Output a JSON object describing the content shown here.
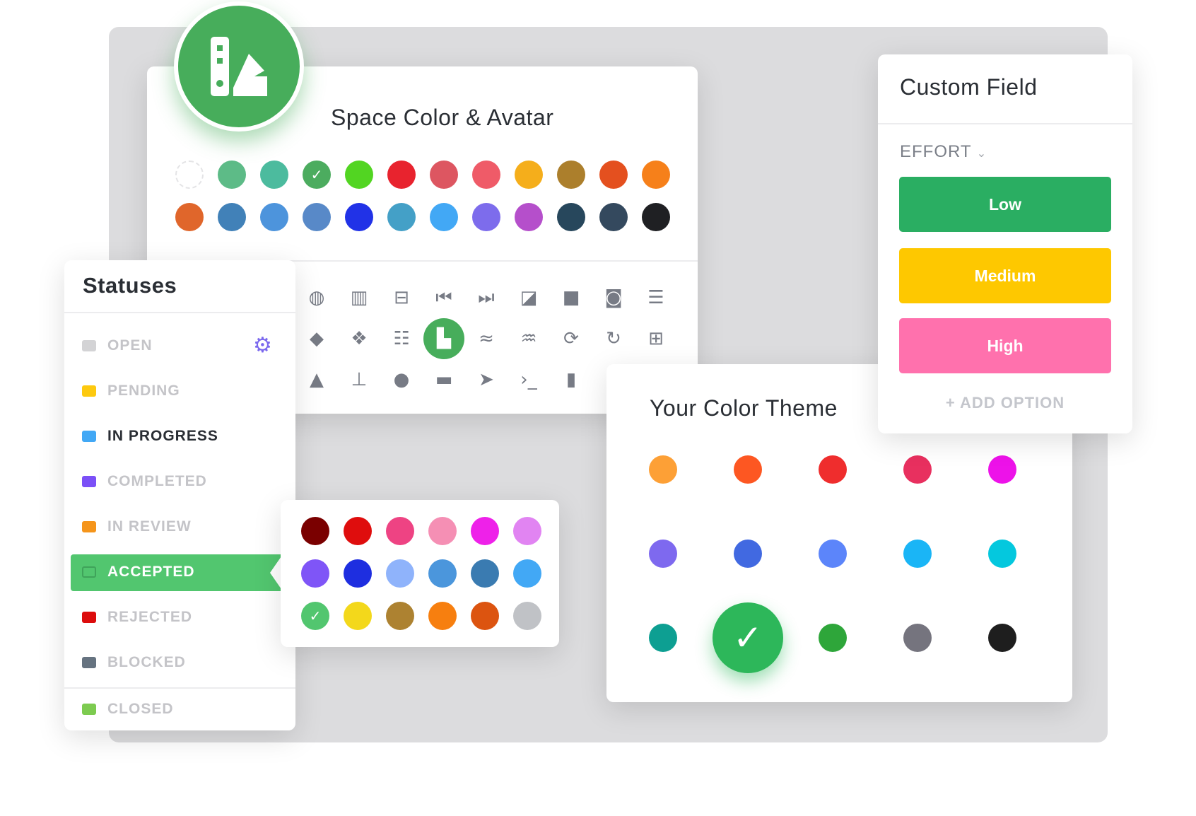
{
  "space": {
    "title": "Space Color & Avatar",
    "colors_row1": [
      "#ffffff",
      "#5dbb87",
      "#4cbb9e",
      "#4cac5f",
      "#52d522",
      "#e8232e",
      "#dd5661",
      "#ef5b68",
      "#f5ae1b",
      "#ac7f2c",
      "#e4501f",
      "#f6801a"
    ],
    "colors_row2": [
      "#e0662b",
      "#4181b8",
      "#4d94dc",
      "#5889c8",
      "#2132e7",
      "#44a0c7",
      "#42a8f5",
      "#7d6cec",
      "#b54fcb",
      "#27475c",
      "#34495e",
      "#1f2023"
    ],
    "selected_color_index": 3,
    "icons": [
      [
        "soccer-ball",
        "◍"
      ],
      [
        "briefcase",
        "▥"
      ],
      [
        "luggage",
        "⊟"
      ],
      [
        "skip-back",
        "⏮"
      ],
      [
        "skip-forward",
        "⏭"
      ],
      [
        "sticky-note",
        "◪"
      ],
      [
        "square",
        "■"
      ],
      [
        "circle-stop",
        "◙"
      ],
      [
        "bars",
        "☰"
      ],
      [
        "tag",
        "◆"
      ],
      [
        "tags",
        "❖"
      ],
      [
        "checklist",
        "☷"
      ],
      [
        "swatch",
        "▙"
      ],
      [
        "swimmer",
        "≈"
      ],
      [
        "pool",
        "♒"
      ],
      [
        "refresh",
        "⟳"
      ],
      [
        "sync",
        "↻"
      ],
      [
        "table",
        "⊞"
      ],
      [
        "thumbs-up",
        "▲"
      ],
      [
        "pushpin",
        "⊥"
      ],
      [
        "drop",
        "●"
      ],
      [
        "car",
        "▬"
      ],
      [
        "paper-plane",
        "➤"
      ],
      [
        "terminal",
        "›_"
      ],
      [
        "thermometer",
        "▮"
      ]
    ],
    "selected_icon_index": 12
  },
  "statuses": {
    "title": "Statuses",
    "items": [
      {
        "label": "OPEN",
        "color": "#d3d3d5"
      },
      {
        "label": "PENDING",
        "color": "#fdc90f"
      },
      {
        "label": "IN PROGRESS",
        "color": "#42a8f5"
      },
      {
        "label": "COMPLETED",
        "color": "#7b50f7"
      },
      {
        "label": "IN REVIEW",
        "color": "#f5951b"
      },
      {
        "label": "ACCEPTED",
        "color": "#52c66f"
      },
      {
        "label": "REJECTED",
        "color": "#dc0c0c"
      },
      {
        "label": "BLOCKED",
        "color": "#667380"
      },
      {
        "label": "CLOSED",
        "color": "#7dcb50"
      }
    ],
    "active_index": 2,
    "selected_index": 5
  },
  "picker": {
    "colors": [
      "#7a0000",
      "#df0d0d",
      "#ee4383",
      "#f58fb4",
      "#ee21e9",
      "#e184f2",
      "#7f55f7",
      "#1e2ee0",
      "#8fb3fb",
      "#4b96dc",
      "#3a7bb1",
      "#42a8f5",
      "#52c66f",
      "#f3d81b",
      "#ad8231",
      "#f77f0f",
      "#dc5410",
      "#c0c2c6"
    ],
    "selected_index": 12
  },
  "theme": {
    "title": "Your Color Theme",
    "colors": [
      "#fda036",
      "#fd5722",
      "#ef2d2d",
      "#e8305f",
      "#ed12e9",
      "#7e69ef",
      "#4169e1",
      "#5c85fa",
      "#1ab5f6",
      "#04c8de",
      "#0d9f92",
      "#2db75a",
      "#2ea63a",
      "#75747e",
      "#1e1e1e"
    ],
    "selected_index": 11
  },
  "custom_field": {
    "title": "Custom Field",
    "field": "EFFORT",
    "options": [
      {
        "label": "Low",
        "color": "#2aae62"
      },
      {
        "label": "Medium",
        "color": "#fec800"
      },
      {
        "label": "High",
        "color": "#ff71ad"
      }
    ],
    "add_label": "+ ADD OPTION"
  }
}
